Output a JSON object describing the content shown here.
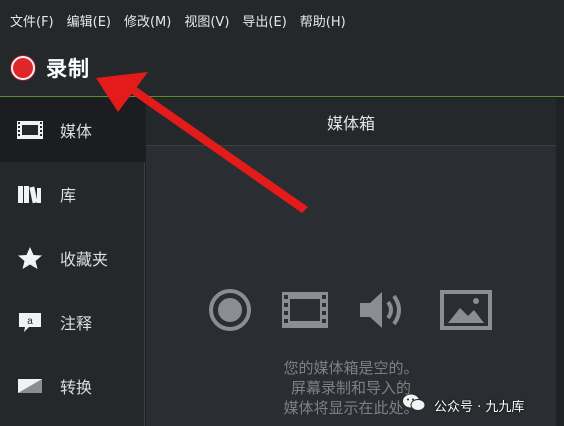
{
  "menu": [
    "文件(F)",
    "编辑(E)",
    "修改(M)",
    "视图(V)",
    "导出(E)",
    "帮助(H)"
  ],
  "record": {
    "label": "录制",
    "color": "#e0252b"
  },
  "sidebar": {
    "items": [
      {
        "label": "媒体",
        "icon": "film-icon",
        "active": true
      },
      {
        "label": "库",
        "icon": "library-books-icon",
        "active": false
      },
      {
        "label": "收藏夹",
        "icon": "star-icon",
        "active": false
      },
      {
        "label": "注释",
        "icon": "annotation-icon",
        "active": false
      },
      {
        "label": "转换",
        "icon": "transition-icon",
        "active": false
      }
    ]
  },
  "media_bin": {
    "title": "媒体箱",
    "empty_lines": [
      "您的媒体箱是空的。",
      "屏幕录制和导入的",
      "媒体将显示在此处。"
    ],
    "icons": [
      "record-icon",
      "film-icon",
      "speaker-icon",
      "image-icon"
    ]
  },
  "watermark": {
    "text": "公众号 · 九九库",
    "icon": "wechat-icon"
  },
  "annotation": {
    "icon": "red-arrow-icon",
    "color": "#e31b1b"
  }
}
